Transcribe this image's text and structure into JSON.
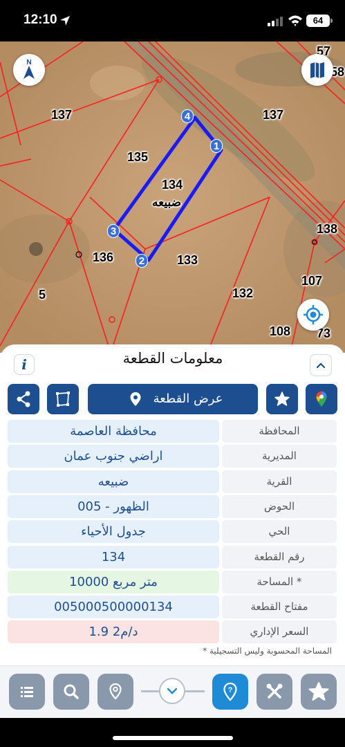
{
  "status": {
    "time": "12:10",
    "battery": "64"
  },
  "map": {
    "labels": {
      "p57": "57",
      "p58": "58",
      "p137_left": "137",
      "p137_right": "137",
      "p135": "135",
      "p134": "134",
      "village_name": "ضبيعه",
      "p138": "138",
      "p136": "136",
      "p133": "133",
      "p107": "107",
      "p5": "5",
      "p132": "132",
      "p108": "108",
      "p73": "73"
    },
    "vertices": [
      "1",
      "2",
      "3",
      "4"
    ],
    "colors": {
      "boundary": "#ff1e1e",
      "parcel_outline": "#1a1aff"
    },
    "icons": {
      "north": "north-arrow-icon",
      "layers": "map-layers-icon",
      "locate": "my-location-icon"
    }
  },
  "panel": {
    "title": "معلومات القطعة",
    "show_parcel_label": "عرض القطعة",
    "rows": [
      {
        "key": "المحافظة",
        "value": "محافظة العاصمة",
        "tone": "blue"
      },
      {
        "key": "المديرية",
        "value": "اراضي جنوب عمان",
        "tone": "blue"
      },
      {
        "key": "القرية",
        "value": "ضبيعه",
        "tone": "blue"
      },
      {
        "key": "الحوض",
        "value": "الظهور - 005",
        "tone": "blue"
      },
      {
        "key": "الحي",
        "value": "جدول الأحياء",
        "tone": "blue"
      },
      {
        "key": "رقم القطعة",
        "value": "134",
        "tone": "blue"
      },
      {
        "key": "المساحة *",
        "value": "10000  متر مربع",
        "tone": "green"
      },
      {
        "key": "مفتاح القطعة",
        "value": "005000500000134",
        "tone": "blue"
      },
      {
        "key": "السعر الإداري",
        "value": "1.9 د/م2",
        "tone": "red"
      }
    ],
    "footnote": "* المساحة المحسوبة وليس التسجيلية"
  },
  "theme": {
    "primary": "#1d4e8f",
    "toolbar_gray": "#8a98ab",
    "toolbar_blue": "#1f8ad6",
    "row_blue": "#e6f0fb",
    "row_green": "#e5f6e3",
    "row_red": "#fbe3e4"
  }
}
